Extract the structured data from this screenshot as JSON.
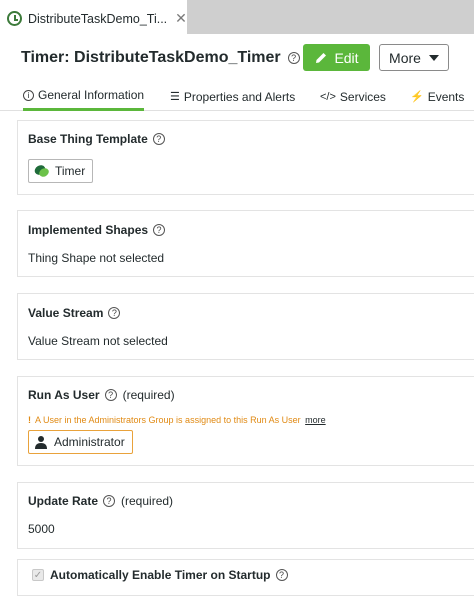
{
  "tab": {
    "label": "DistributeTaskDemo_Ti...",
    "close": "✕"
  },
  "header": {
    "title": "Timer: DistributeTaskDemo_Timer",
    "help": "?",
    "edit_label": "Edit",
    "more_label": "More"
  },
  "nav": {
    "tabs": [
      {
        "icon": "i",
        "label": "General Information"
      },
      {
        "icon": "☰",
        "label": "Properties and Alerts"
      },
      {
        "icon": "</>",
        "label": "Services"
      },
      {
        "icon": "⚡",
        "label": "Events"
      }
    ]
  },
  "sections": {
    "base_template": {
      "title": "Base Thing Template",
      "help": "?",
      "chip": "Timer"
    },
    "implemented_shapes": {
      "title": "Implemented Shapes",
      "help": "?",
      "text": "Thing Shape not selected"
    },
    "value_stream": {
      "title": "Value Stream",
      "help": "?",
      "text": "Value Stream not selected"
    },
    "run_as_user": {
      "title": "Run As User",
      "help": "?",
      "required": "(required)",
      "warning_mark": "!",
      "warning": "A User in the Administrators Group is assigned to this Run As User",
      "warning_link": "more",
      "chip": "Administrator"
    },
    "update_rate": {
      "title": "Update Rate",
      "help": "?",
      "required": "(required)",
      "value": "5000"
    },
    "auto_enable": {
      "label": "Automatically Enable Timer on Startup",
      "help": "?",
      "checked": true
    }
  },
  "colors": {
    "accent": "#5bb73b",
    "warning": "#e08a14"
  }
}
